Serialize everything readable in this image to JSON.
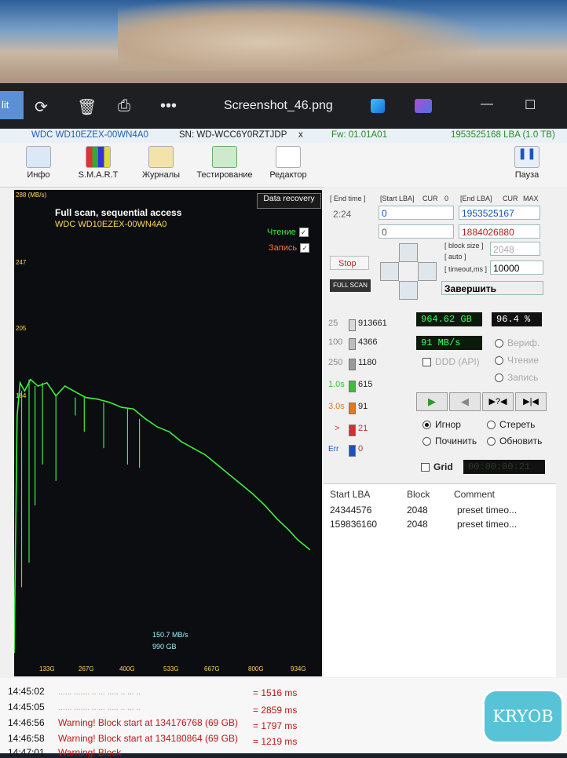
{
  "titlebar": {
    "edit_label": "lit",
    "title": "Screenshot_46.png"
  },
  "drive": {
    "model": "WDC WD10EZEX-00WN4A0",
    "serial": "SN: WD-WCC6Y0RZTJDP",
    "close": "x",
    "firmware": "Fw: 01.01A01",
    "capacity": "1953525168 LBA (1.0 TB)"
  },
  "toolbar": {
    "items": [
      {
        "label": "Инфо",
        "icon": "info-icon"
      },
      {
        "label": "S.M.A.R.T",
        "icon": "smart-icon"
      },
      {
        "label": "Журналы",
        "icon": "logs-icon"
      },
      {
        "label": "Тестирование",
        "icon": "test-icon"
      },
      {
        "label": "Редактор",
        "icon": "editor-icon"
      }
    ],
    "pause": "Пауза"
  },
  "chart_data": {
    "type": "line",
    "title": "Full scan, sequential access",
    "subtitle": "WDC WD10EZEX-00WN4A0",
    "y_unit": "288 (MB/s)",
    "yticks": [
      "247",
      "205",
      "164"
    ],
    "xticks": [
      "133G",
      "267G",
      "400G",
      "533G",
      "667G",
      "800G",
      "934G"
    ],
    "ylim": [
      0,
      288
    ],
    "xlim": [
      0,
      1000
    ],
    "series": [
      {
        "name": "Чтение",
        "color": "#3ef03e",
        "x": [
          0,
          10,
          20,
          35,
          55,
          80,
          110,
          140,
          170,
          200,
          240,
          280,
          320,
          360,
          400,
          440,
          480,
          520,
          560,
          600,
          640,
          680,
          720,
          760,
          800,
          840,
          880,
          920,
          950,
          990
        ],
        "y": [
          5,
          150,
          170,
          165,
          172,
          168,
          170,
          162,
          168,
          165,
          161,
          160,
          158,
          155,
          154,
          148,
          143,
          140,
          134,
          130,
          126,
          120,
          114,
          108,
          102,
          95,
          87,
          80,
          74,
          68
        ]
      }
    ],
    "dropouts": [
      {
        "x": 25,
        "y": 45
      },
      {
        "x": 50,
        "y": 60
      },
      {
        "x": 70,
        "y": 95
      },
      {
        "x": 95,
        "y": 120
      },
      {
        "x": 140,
        "y": 110
      },
      {
        "x": 205,
        "y": 150
      },
      {
        "x": 235,
        "y": 140
      },
      {
        "x": 300,
        "y": 130
      },
      {
        "x": 380,
        "y": 120
      },
      {
        "x": 420,
        "y": 118
      }
    ],
    "current_speed": "150.7 MB/s",
    "current_position": "990 GB",
    "legend": [
      {
        "label": "Чтение",
        "checked": true,
        "color": "#3ef03e"
      },
      {
        "label": "Запись",
        "checked": true,
        "color": "#ff6f4a"
      }
    ],
    "data_recovery": "Data recovery"
  },
  "control": {
    "end_time_label": "[ End time ]",
    "end_time": "2:24",
    "start_lba_label": "[Start LBA]",
    "cur": "CUR",
    "zero": "0",
    "start_lba": "0",
    "start_lba2": "0",
    "end_lba_label": "[End LBA]",
    "max": "MAX",
    "end_lba": "1953525167",
    "end_lba2": "1884026880",
    "stop": "Stop",
    "full_scan": "FULL SCAN",
    "block_size_label": "[ block size ]",
    "auto_label": "[ auto ]",
    "block_size": "2048",
    "timeout_label": "[ timeout,ms ]",
    "timeout": "10000",
    "finish": "Завершить"
  },
  "counters": [
    {
      "label": "25",
      "value": "913661",
      "color": "#cfcfcf"
    },
    {
      "label": "100",
      "value": "4366",
      "color": "#b8b8b8"
    },
    {
      "label": "250",
      "value": "1180",
      "color": "#9a9a9a"
    },
    {
      "label": "1.0s",
      "value": "615",
      "color": "#3cbf3c"
    },
    {
      "label": "3.0s",
      "value": "91",
      "color": "#e07a20"
    },
    {
      "label": ">",
      "value": "21",
      "color": "#d03030"
    },
    {
      "label": "Err",
      "value": "0",
      "color": "#2050c0"
    }
  ],
  "status": {
    "processed": "964.62 GB",
    "percent": "96.4  %",
    "speed": "91 MB/s",
    "verify": "Вериф.",
    "ddd": "DDD (API)",
    "read": "Чтение",
    "write": "Запись"
  },
  "playback": {
    "play": "▶",
    "back": "◀",
    "skip": "▶?◀",
    "end": "▶|◀"
  },
  "actions": {
    "ignore": "Игнор",
    "erase": "Стереть",
    "repair": "Починить",
    "refresh": "Обновить",
    "grid": "Grid",
    "grid_value": "00:00:00:21"
  },
  "errors": {
    "headers": [
      "Start LBA",
      "Block",
      "Comment"
    ],
    "rows": [
      [
        "24344576",
        "2048",
        "preset timeo..."
      ],
      [
        "159836160",
        "2048",
        "preset timeo..."
      ]
    ]
  },
  "log": [
    {
      "time": "14:45:02",
      "msg": "...... ....... .. ... ..... .. ... ..",
      "ms": "= 1516 ms",
      "kind": "blur"
    },
    {
      "time": "14:45:05",
      "msg": "...... ....... .. ... ..... .. ... ..",
      "ms": "= 2859 ms",
      "kind": "blur"
    },
    {
      "time": "14:46:56",
      "msg": "Warning! Block start at 134176768 (69 GB)",
      "ms": "= 1797 ms",
      "kind": "warn"
    },
    {
      "time": "14:46:58",
      "msg": "Warning! Block start at 134180864 (69 GB)",
      "ms": "= 1219 ms",
      "kind": "warn"
    },
    {
      "time": "14:47:01",
      "msg": "Warning! Block",
      "ms": "",
      "kind": "warn"
    }
  ],
  "watermark": "KRYOB"
}
